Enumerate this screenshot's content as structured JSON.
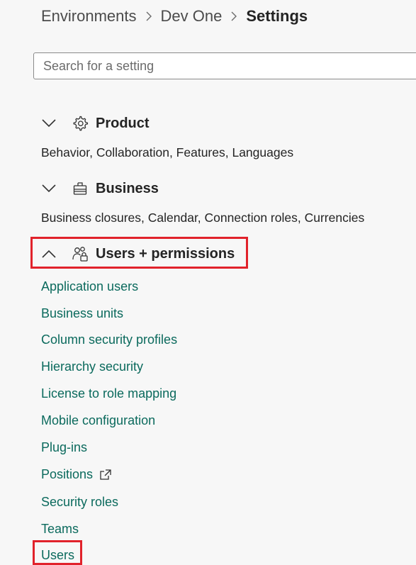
{
  "breadcrumb": {
    "items": [
      "Environments",
      "Dev One"
    ],
    "current": "Settings"
  },
  "search": {
    "placeholder": "Search for a setting",
    "value": ""
  },
  "sections": {
    "product": {
      "title": "Product",
      "description": "Behavior, Collaboration, Features, Languages",
      "expanded": false,
      "icon": "gear-icon"
    },
    "business": {
      "title": "Business",
      "description": "Business closures, Calendar, Connection roles, Currencies",
      "expanded": false,
      "icon": "business-icon"
    },
    "users_permissions": {
      "title": "Users + permissions",
      "expanded": true,
      "icon": "people-lock-icon",
      "links": [
        "Application users",
        "Business units",
        "Column security profiles",
        "Hierarchy security",
        "License to role mapping",
        "Mobile configuration",
        "Plug-ins",
        "Positions",
        "Security roles",
        "Teams",
        "Users"
      ]
    }
  },
  "colors": {
    "link": "#0b6a5d",
    "highlight": "#e1222b",
    "background": "#f7f7f7"
  }
}
